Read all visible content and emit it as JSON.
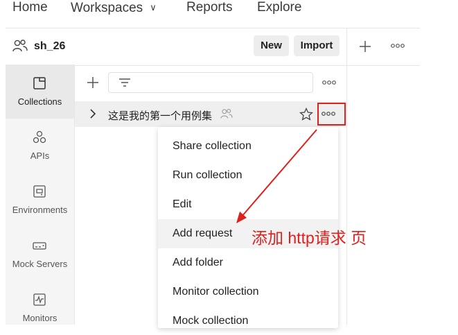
{
  "top_nav": {
    "items": [
      "Home",
      "Workspaces",
      "Reports",
      "Explore"
    ]
  },
  "workspace": {
    "name": "sh_26",
    "new_label": "New",
    "import_label": "Import"
  },
  "sidebar": {
    "items": [
      {
        "label": "Collections",
        "icon": "collections-icon",
        "active": true
      },
      {
        "label": "APIs",
        "icon": "apis-icon",
        "active": false
      },
      {
        "label": "Environments",
        "icon": "environments-icon",
        "active": false
      },
      {
        "label": "Mock Servers",
        "icon": "mock-servers-icon",
        "active": false
      },
      {
        "label": "Monitors",
        "icon": "monitors-icon",
        "active": false
      }
    ]
  },
  "collections": {
    "items": [
      {
        "name": "这是我的第一个用例集",
        "shared": true,
        "icons": [
          "chevron-right-icon",
          "team-icon",
          "star-icon",
          "more-icon"
        ]
      }
    ]
  },
  "context_menu": {
    "items": [
      {
        "label": "Share collection",
        "hovered": false
      },
      {
        "label": "Run collection",
        "hovered": false
      },
      {
        "label": "Edit",
        "hovered": false
      },
      {
        "label": "Add request",
        "hovered": true
      },
      {
        "label": "Add folder",
        "hovered": false
      },
      {
        "label": "Monitor collection",
        "hovered": false
      },
      {
        "label": "Mock collection",
        "hovered": false
      }
    ]
  },
  "annotation": {
    "text": "添加 http请求 页",
    "color": "#e0201d"
  },
  "colors": {
    "accent_red": "#e0201d",
    "sidebar_bg": "#f5f5f5",
    "button_bg": "#ededed"
  }
}
